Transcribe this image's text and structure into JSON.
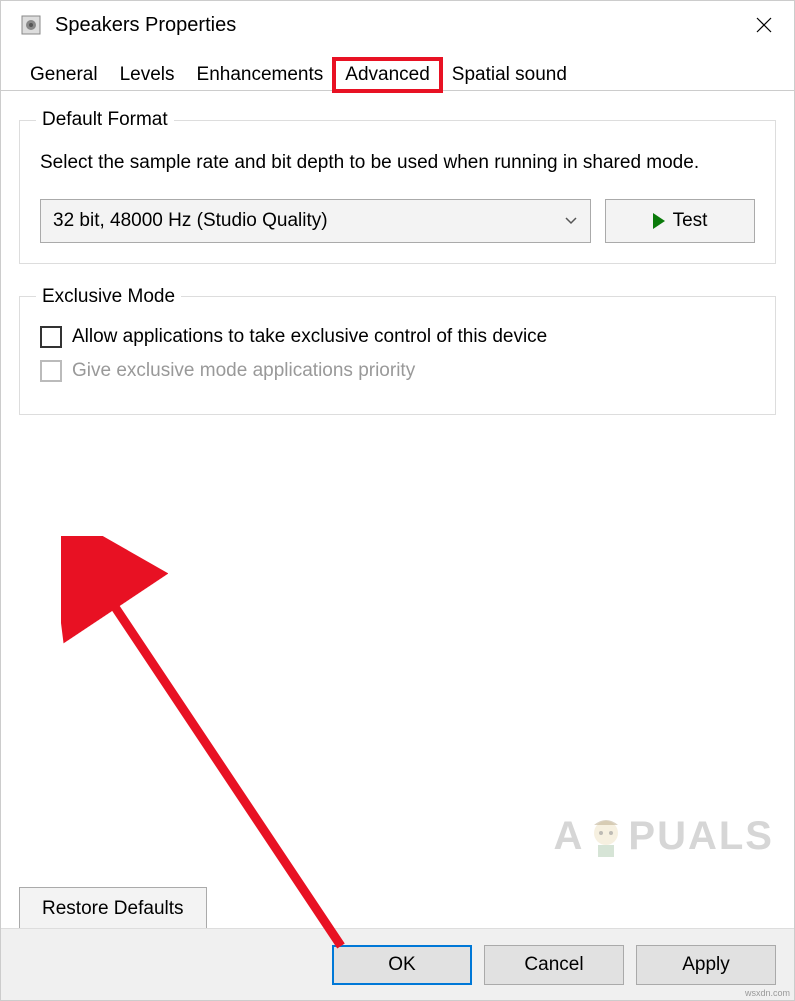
{
  "window": {
    "title": "Speakers Properties"
  },
  "tabs": {
    "general": "General",
    "levels": "Levels",
    "enhancements": "Enhancements",
    "advanced": "Advanced",
    "spatial": "Spatial sound"
  },
  "default_format": {
    "legend": "Default Format",
    "desc": "Select the sample rate and bit depth to be used when running in shared mode.",
    "selected": "32 bit, 48000 Hz (Studio Quality)",
    "test_label": "Test"
  },
  "exclusive_mode": {
    "legend": "Exclusive Mode",
    "allow_label": "Allow applications to take exclusive control of this device",
    "priority_label": "Give exclusive mode applications priority"
  },
  "buttons": {
    "restore": "Restore Defaults",
    "ok": "OK",
    "cancel": "Cancel",
    "apply": "Apply"
  },
  "watermark": {
    "text_a": "A",
    "text_b": "PUALS"
  },
  "credit": "wsxdn.com"
}
